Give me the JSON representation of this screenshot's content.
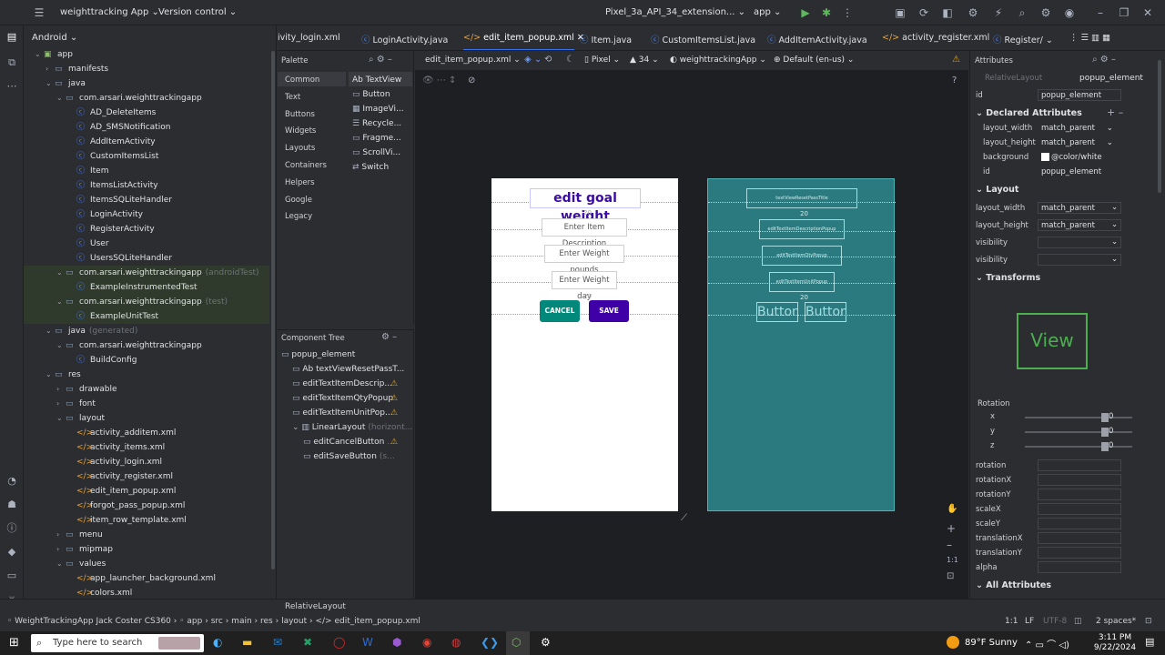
{
  "topbar": {
    "project": "weighttracking App",
    "vcs": "Version control",
    "device": "Pixel_3a_API_34_extension...",
    "module": "app"
  },
  "leftstrip": {
    "project_label": "Android"
  },
  "tree": [
    {
      "label": "app",
      "indent": 0,
      "icon": "module-icon",
      "arrow": "v"
    },
    {
      "label": "manifests",
      "indent": 1,
      "icon": "folder-icon",
      "arrow": ">"
    },
    {
      "label": "java",
      "indent": 1,
      "icon": "folder-icon",
      "arrow": "v"
    },
    {
      "label": "com.arsari.weighttrackingapp",
      "indent": 2,
      "icon": "package-icon",
      "arrow": "v"
    },
    {
      "label": "AD_DeleteItems",
      "indent": 3,
      "icon": "class-icon",
      "arrow": ""
    },
    {
      "label": "AD_SMSNotification",
      "indent": 3,
      "icon": "class-icon",
      "arrow": ""
    },
    {
      "label": "AddItemActivity",
      "indent": 3,
      "icon": "class-icon",
      "arrow": ""
    },
    {
      "label": "CustomItemsList",
      "indent": 3,
      "icon": "class-icon",
      "arrow": ""
    },
    {
      "label": "Item",
      "indent": 3,
      "icon": "class-icon",
      "arrow": ""
    },
    {
      "label": "ItemsListActivity",
      "indent": 3,
      "icon": "class-icon",
      "arrow": ""
    },
    {
      "label": "ItemsSQLiteHandler",
      "indent": 3,
      "icon": "class-icon",
      "arrow": ""
    },
    {
      "label": "LoginActivity",
      "indent": 3,
      "icon": "class-icon",
      "arrow": ""
    },
    {
      "label": "RegisterActivity",
      "indent": 3,
      "icon": "class-icon",
      "arrow": ""
    },
    {
      "label": "User",
      "indent": 3,
      "icon": "class-icon",
      "arrow": ""
    },
    {
      "label": "UsersSQLiteHandler",
      "indent": 3,
      "icon": "class-icon",
      "arrow": ""
    },
    {
      "label": "com.arsari.weighttrackingapp",
      "suffix": "(androidTest)",
      "indent": 2,
      "icon": "package-icon",
      "arrow": "v",
      "hl": true
    },
    {
      "label": "ExampleInstrumentedTest",
      "indent": 3,
      "icon": "class-icon",
      "arrow": "",
      "hl": true
    },
    {
      "label": "com.arsari.weighttrackingapp",
      "suffix": "(test)",
      "indent": 2,
      "icon": "package-icon",
      "arrow": "v",
      "hl": true
    },
    {
      "label": "ExampleUnitTest",
      "indent": 3,
      "icon": "class-icon",
      "arrow": "",
      "hl": true
    },
    {
      "label": "java",
      "suffix": "(generated)",
      "indent": 1,
      "icon": "folder-icon",
      "arrow": "v"
    },
    {
      "label": "com.arsari.weighttrackingapp",
      "indent": 2,
      "icon": "package-icon",
      "arrow": "v"
    },
    {
      "label": "BuildConfig",
      "indent": 3,
      "icon": "class-icon",
      "arrow": ""
    },
    {
      "label": "res",
      "indent": 1,
      "icon": "folder-icon",
      "arrow": "v"
    },
    {
      "label": "drawable",
      "indent": 2,
      "icon": "folder-icon",
      "arrow": ">"
    },
    {
      "label": "font",
      "indent": 2,
      "icon": "folder-icon",
      "arrow": ">"
    },
    {
      "label": "layout",
      "indent": 2,
      "icon": "folder-icon",
      "arrow": "v"
    },
    {
      "label": "activity_additem.xml",
      "indent": 3,
      "icon": "xml-icon",
      "arrow": ""
    },
    {
      "label": "activity_items.xml",
      "indent": 3,
      "icon": "xml-icon",
      "arrow": ""
    },
    {
      "label": "activity_login.xml",
      "indent": 3,
      "icon": "xml-icon",
      "arrow": ""
    },
    {
      "label": "activity_register.xml",
      "indent": 3,
      "icon": "xml-icon",
      "arrow": ""
    },
    {
      "label": "edit_item_popup.xml",
      "indent": 3,
      "icon": "xml-icon",
      "arrow": ""
    },
    {
      "label": "forgot_pass_popup.xml",
      "indent": 3,
      "icon": "xml-icon",
      "arrow": ""
    },
    {
      "label": "item_row_template.xml",
      "indent": 3,
      "icon": "xml-icon",
      "arrow": ""
    },
    {
      "label": "menu",
      "indent": 2,
      "icon": "folder-icon",
      "arrow": ">"
    },
    {
      "label": "mipmap",
      "indent": 2,
      "icon": "folder-icon",
      "arrow": ">"
    },
    {
      "label": "values",
      "indent": 2,
      "icon": "folder-icon",
      "arrow": "v"
    },
    {
      "label": "app_launcher_background.xml",
      "indent": 3,
      "icon": "xml-icon",
      "arrow": ""
    },
    {
      "label": "colors.xml",
      "indent": 3,
      "icon": "xml-icon",
      "arrow": ""
    }
  ],
  "tabs": [
    "ivity_login.xml",
    "LoginActivity.java",
    "edit_item_popup.xml",
    "Item.java",
    "CustomItemsList.java",
    "AddItemActivity.java",
    "activity_register.xml",
    "Register/"
  ],
  "palette": {
    "title": "Palette",
    "categories": [
      "Common",
      "Text",
      "Buttons",
      "Widgets",
      "Layouts",
      "Containers",
      "Helpers",
      "Google",
      "Legacy"
    ],
    "items": [
      "Ab TextView",
      "Button",
      "ImageVi...",
      "Recycle...",
      "Fragme...",
      "ScrollVi...",
      "Switch"
    ]
  },
  "design_toolbar": {
    "file": "edit_item_popup.xml",
    "device": "Pixel",
    "api": "34",
    "theme": "weighttrackingApp",
    "locale": "Default (en-us)"
  },
  "component_tree": {
    "title": "Component Tree",
    "rows": [
      {
        "label": "popup_element",
        "indent": 0,
        "warn": false
      },
      {
        "label": "Ab textViewResetPassT...",
        "indent": 1,
        "warn": false
      },
      {
        "label": "editTextItemDescrip...",
        "indent": 1,
        "warn": true
      },
      {
        "label": "editTextItemQtyPopup",
        "indent": 1,
        "warn": true
      },
      {
        "label": "editTextItemUnitPop...",
        "indent": 1,
        "warn": true
      },
      {
        "label": "LinearLayout",
        "suffix": "(horizont...",
        "indent": 1,
        "warn": false
      },
      {
        "label": "editCancelButton",
        "suffix": "...",
        "indent": 2,
        "warn": true
      },
      {
        "label": "editSaveButton",
        "suffix": "(s...",
        "indent": 2,
        "warn": false
      }
    ]
  },
  "preview": {
    "title": "edit goal weight",
    "field1": "Enter Item Description",
    "field2": "Enter Weight pounds",
    "field3": "Enter Weight day",
    "cancel": "CANCEL",
    "save": "SAVE",
    "margin": "20",
    "bp_title": "textViewResetPassTitle",
    "bp_f1": "editTextItemDescriptionPopup",
    "bp_f2": "editTextItemQtyPopup",
    "bp_f3": "editTextItemUnitPopup",
    "bp_b1": "Button",
    "bp_b2": "Button"
  },
  "attributes": {
    "title": "Attributes",
    "type": "RelativeLayout",
    "name": "popup_element",
    "id_label": "id",
    "id_value": "popup_element",
    "declared": "Declared Attributes",
    "declared_rows": [
      {
        "k": "layout_width",
        "v": "match_parent"
      },
      {
        "k": "layout_height",
        "v": "match_parent"
      },
      {
        "k": "background",
        "v": "@color/white"
      },
      {
        "k": "id",
        "v": "popup_element"
      }
    ],
    "layout": "Layout",
    "layout_rows": [
      {
        "k": "layout_width",
        "v": "match_parent"
      },
      {
        "k": "layout_height",
        "v": "match_parent"
      },
      {
        "k": "visibility",
        "v": ""
      },
      {
        "k": "visibility",
        "v": ""
      }
    ],
    "transforms": "Transforms",
    "view_label": "View",
    "rotation": "Rotation",
    "rot_rows": [
      {
        "k": "x",
        "v": "0"
      },
      {
        "k": "y",
        "v": "0"
      },
      {
        "k": "z",
        "v": "0"
      }
    ],
    "more_rows": [
      "rotation",
      "rotationX",
      "rotationY",
      "scaleX",
      "scaleY",
      "translationX",
      "translationY",
      "alpha"
    ],
    "all": "All Attributes"
  },
  "status": {
    "bottom_label": "RelativeLayout",
    "crumbs": [
      "WeightTrackingApp Jack Coster CS360",
      "app",
      "src",
      "main",
      "res",
      "layout",
      "edit_item_popup.xml"
    ],
    "pos": "1:1",
    "lf": "LF",
    "enc": "UTF-8",
    "indent": "2 spaces*"
  },
  "taskbar": {
    "search": "Type here to search",
    "weather": "89°F  Sunny",
    "time": "3:11 PM",
    "date": "9/22/2024"
  },
  "colors": {
    "accent": "#3574f0",
    "teal_button": "#00897b",
    "purple_button": "#3f00a8",
    "title_purple": "#3a0ca3",
    "blueprint": "#2a7a7f"
  }
}
